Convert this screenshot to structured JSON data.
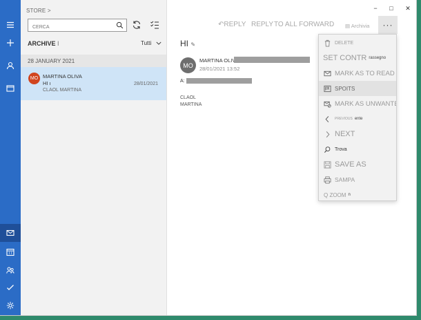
{
  "window": {
    "title": "STORE >",
    "controls": [
      "−",
      "□",
      "✕"
    ]
  },
  "rail": {
    "icons": [
      "hamburger-icon",
      "plus-icon",
      "person-icon",
      "folder-icon",
      "mail-icon",
      "calendar-icon",
      "people-icon",
      "checkmark-icon",
      "gear-icon"
    ]
  },
  "list": {
    "search_placeholder": "CERCA",
    "folder_name": "ARCHIVE",
    "folder_suffix": "I",
    "filter_label": "Tutti",
    "date_group": "28 JANUARY 2021",
    "items": [
      {
        "avatar": "MO",
        "from": "MARTINA OLIVA",
        "subject": "HI ı",
        "preview": "CLAOL MARTINA",
        "date": "28/01/2021"
      }
    ]
  },
  "toolbar": {
    "reply": "REPLY",
    "reply_all": "REPLY",
    "forward": "TO ALL FORWARD",
    "archive": "Archivia",
    "more": "···"
  },
  "message": {
    "subject": "HI",
    "subject_icon": "✎",
    "avatar": "MO",
    "from": "MARTINA OLIVA <",
    "date": "28/01/2021 13:52",
    "to_label": "A:",
    "body_line1": "CLAOL",
    "body_line2": "MARTINA"
  },
  "menu": {
    "items": [
      {
        "icon": "trash-icon",
        "label": "DELETE",
        "sub": ""
      },
      {
        "icon": "",
        "label": "SET CONTR",
        "sub": "rassegno"
      },
      {
        "icon": "envelope-icon",
        "label": "MARK AS TO READ",
        "sub": ""
      },
      {
        "icon": "flag-box-icon",
        "label": "SPOITS",
        "sub": ""
      },
      {
        "icon": "envelope-block-icon",
        "label": "MARK AS UNWANTED",
        "sub": ""
      },
      {
        "icon": "chevron-left-icon",
        "label": "PREVIOUS",
        "sub": "ente"
      },
      {
        "icon": "chevron-right-icon",
        "label": "NEXT",
        "sub": ""
      },
      {
        "icon": "search-icon",
        "label": "Trova",
        "sub": ""
      },
      {
        "icon": "save-icon",
        "label": "SAVE AS",
        "sub": ""
      },
      {
        "icon": "printer-icon",
        "label": "SAMPA",
        "sub": ""
      },
      {
        "icon": "zoom-icon",
        "label": "Q ZOOM",
        "sub": "n"
      }
    ]
  }
}
